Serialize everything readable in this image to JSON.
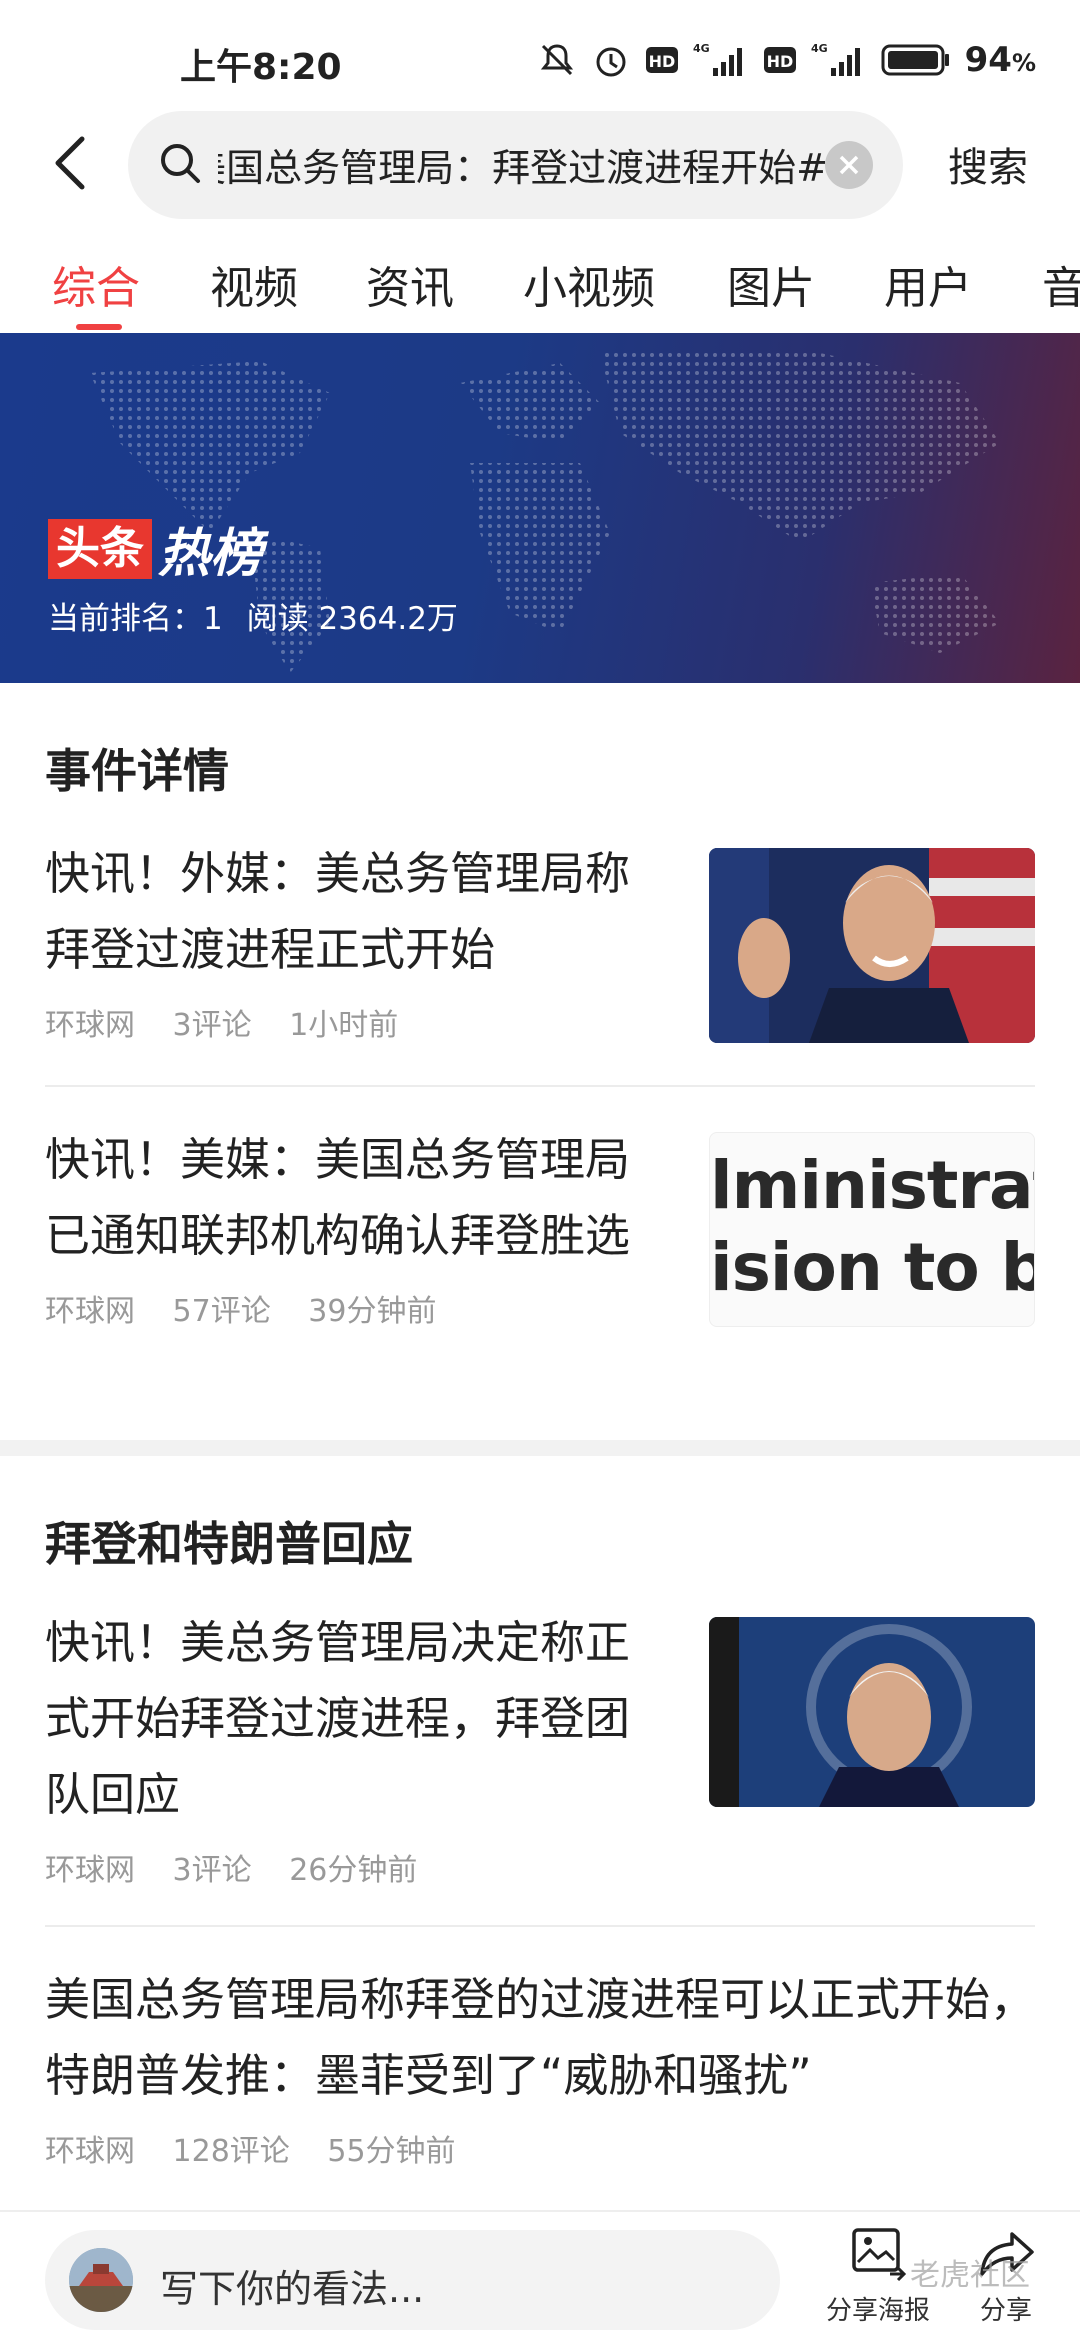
{
  "status_bar": {
    "time": "上午8:20",
    "battery_percent": "94",
    "battery_unit": "%",
    "network_1": "4G",
    "network_2": "4G",
    "hd_1": "HD",
    "hd_2": "HD"
  },
  "search": {
    "query": "美国总务管理局：拜登过渡进程开始#",
    "button_label": "搜索"
  },
  "tabs": [
    "综合",
    "视频",
    "资讯",
    "小视频",
    "图片",
    "用户",
    "音"
  ],
  "active_tab": "综合",
  "banner": {
    "logo_box": "头条",
    "logo_word": "热榜",
    "rank_label": "当前排名：1",
    "read_label": "阅读 2364.2万"
  },
  "sections": [
    {
      "title": "事件详情",
      "articles": [
        {
          "title": "快讯！外媒：美总务管理局称拜登过渡进程正式开始",
          "source": "环球网",
          "comments": "3评论",
          "time": "1小时前",
          "thumb": "photo"
        },
        {
          "title": "快讯！美媒：美国总务管理局已通知联邦机构确认拜登胜选",
          "source": "环球网",
          "comments": "57评论",
          "time": "39分钟前",
          "thumb": "text",
          "thumb_line1": "lministratio",
          "thumb_line2": "ision to be"
        }
      ]
    },
    {
      "title": "拜登和特朗普回应",
      "articles": [
        {
          "title": "快讯！美总务管理局决定称正式开始拜登过渡进程，拜登团队回应",
          "source": "环球网",
          "comments": "3评论",
          "time": "26分钟前",
          "thumb": "photo"
        },
        {
          "title": "美国总务管理局称拜登的过渡进程可以正式开始，特朗普发推：墨菲受到了“威胁和骚扰”",
          "source": "环球网",
          "comments": "128评论",
          "time": "55分钟前",
          "thumb": "none"
        }
      ]
    }
  ],
  "bottom_bar": {
    "comment_placeholder": "写下你的看法...",
    "share_poster_label": "分享海报",
    "share_label": "分享",
    "watermark": "老虎社区"
  },
  "colors": {
    "accent": "#f04142",
    "meta_text": "#999999",
    "banner_blue": "#1b3a8c"
  }
}
